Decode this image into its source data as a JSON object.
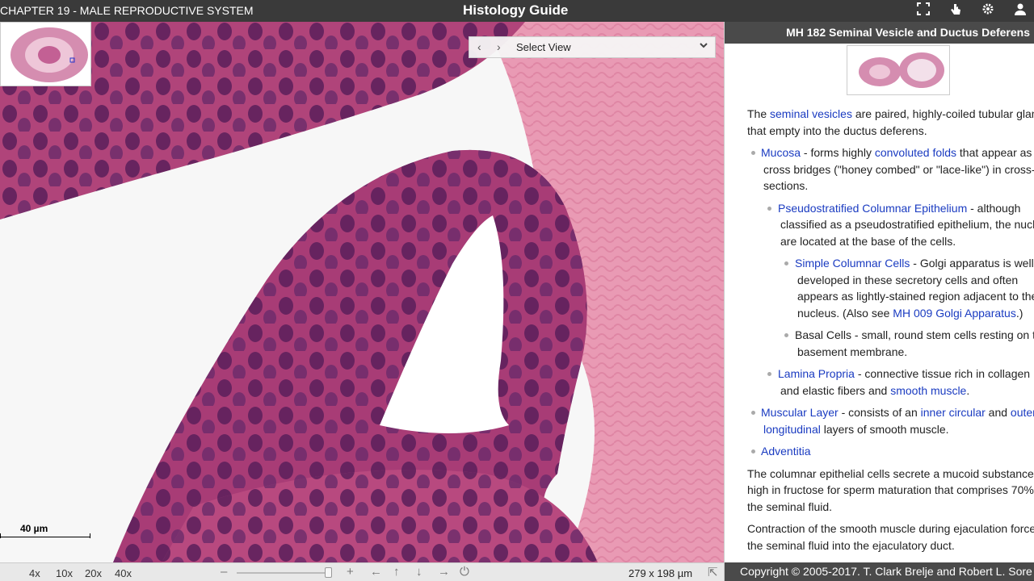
{
  "topbar": {
    "chapter": "CHAPTER 19 - MALE REPRODUCTIVE SYSTEM",
    "title": "Histology Guide",
    "icons": [
      "fullscreen-icon",
      "pointer-icon",
      "gear-icon",
      "user-icon"
    ]
  },
  "viewer": {
    "select_view": "Select View",
    "prev": "‹",
    "next": "›",
    "scale_label": "40 µm"
  },
  "bottombar": {
    "zooms": [
      "4x",
      "10x",
      "20x",
      "40x"
    ],
    "minus": "–",
    "plus": "+",
    "arrows": [
      "←",
      "↑",
      "↓",
      "→"
    ],
    "power": "⏻",
    "dims": "279 x 198 µm",
    "home": "⇱"
  },
  "panel": {
    "header": "MH 182 Seminal Vesicle and Ductus Deferens",
    "intro_a": "The ",
    "intro_link": "seminal vesicles",
    "intro_b": " are paired, highly-coiled tubular glan",
    "intro_c": "that empty into the ductus deferens.",
    "mucosa_link": "Mucosa",
    "mucosa_a": " - forms highly ",
    "mucosa_link2": "convoluted folds",
    "mucosa_b": " that appear as",
    "mucosa_c": "cross bridges (\"honey combed\" or \"lace-like\") in cross-",
    "mucosa_d": "sections.",
    "pce_link": "Pseudostratified Columnar Epithelium",
    "pce_a": " - although",
    "pce_b": "classified as a pseudostratified epithelium, the nucl",
    "pce_c": "are located at the base of the cells.",
    "scc_link": "Simple Columnar Cells",
    "scc_a": " - Golgi apparatus is well-",
    "scc_b": "developed in these secretory cells and often",
    "scc_c": "appears as lightly-stained region adjacent to the",
    "scc_d": "nucleus. (Also see ",
    "scc_link2": "MH 009 Golgi Apparatus",
    "scc_e": ".)",
    "basal_a": "Basal Cells - small, round stem cells resting on t",
    "basal_b": "basement membrane.",
    "lp_link": "Lamina Propria",
    "lp_a": " - connective tissue rich in collagen",
    "lp_b": "and elastic fibers and ",
    "lp_link2": "smooth muscle",
    "lp_c": ".",
    "ml_link": "Muscular Layer",
    "ml_a": " - consists of an ",
    "ml_link2": "inner circular",
    "ml_b": " and ",
    "ml_link3": "outer",
    "ml_link4": "longitudinal",
    "ml_c": " layers of smooth muscle.",
    "adv_link": "Adventitia",
    "p2_a": "The columnar epithelial cells secrete a mucoid substance",
    "p2_b": "high in fructose for sperm maturation that comprises 70%",
    "p2_c": "the seminal fluid.",
    "p3_a": "Contraction of the smooth muscle during ejaculation force",
    "p3_b": "the seminal fluid into the ejaculatory duct.",
    "footer": "Copyright © 2005-2017. T. Clark Brelje and Robert L. Sore"
  }
}
